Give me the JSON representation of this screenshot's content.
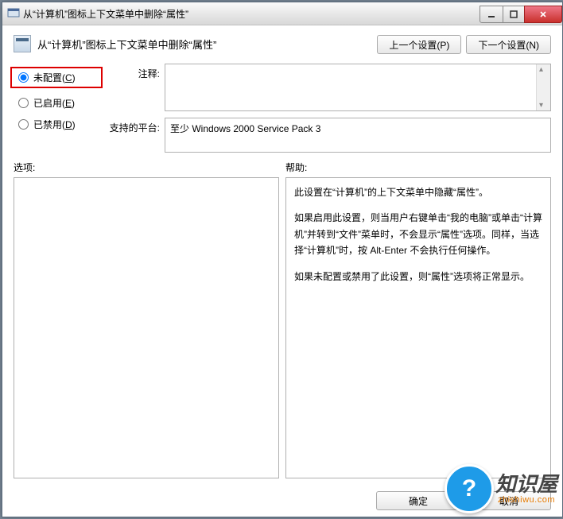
{
  "title": "从“计算机”图标上下文菜单中删除“属性”",
  "header_text": "从“计算机”图标上下文菜单中删除“属性”",
  "nav": {
    "prev": "上一个设置(P)",
    "next": "下一个设置(N)"
  },
  "radios": {
    "unconfigured": {
      "label": "未配置(",
      "accel": "C",
      "tail": ")",
      "checked": true
    },
    "enabled": {
      "label": "已启用(",
      "accel": "E",
      "tail": ")",
      "checked": false
    },
    "disabled": {
      "label": "已禁用(",
      "accel": "D",
      "tail": ")",
      "checked": false
    }
  },
  "fields": {
    "comment_label": "注释:",
    "comment_value": "",
    "platform_label": "支持的平台:",
    "platform_value": "至少 Windows 2000 Service Pack 3"
  },
  "sections": {
    "options_label": "选项:",
    "help_label": "帮助:"
  },
  "help_lines": [
    "此设置在“计算机”的上下文菜单中隐藏“属性”。",
    "如果启用此设置，则当用户右键单击“我的电脑”或单击“计算机”并转到“文件”菜单时，不会显示“属性”选项。同样，当选择“计算机”时，按 Alt-Enter 不会执行任何操作。",
    "如果未配置或禁用了此设置，则“属性”选项将正常显示。"
  ],
  "footer": {
    "ok": "确定",
    "cancel": "取消"
  },
  "watermark": {
    "q": "?",
    "cn": "知识屋",
    "en": "zhishiwu.com"
  }
}
